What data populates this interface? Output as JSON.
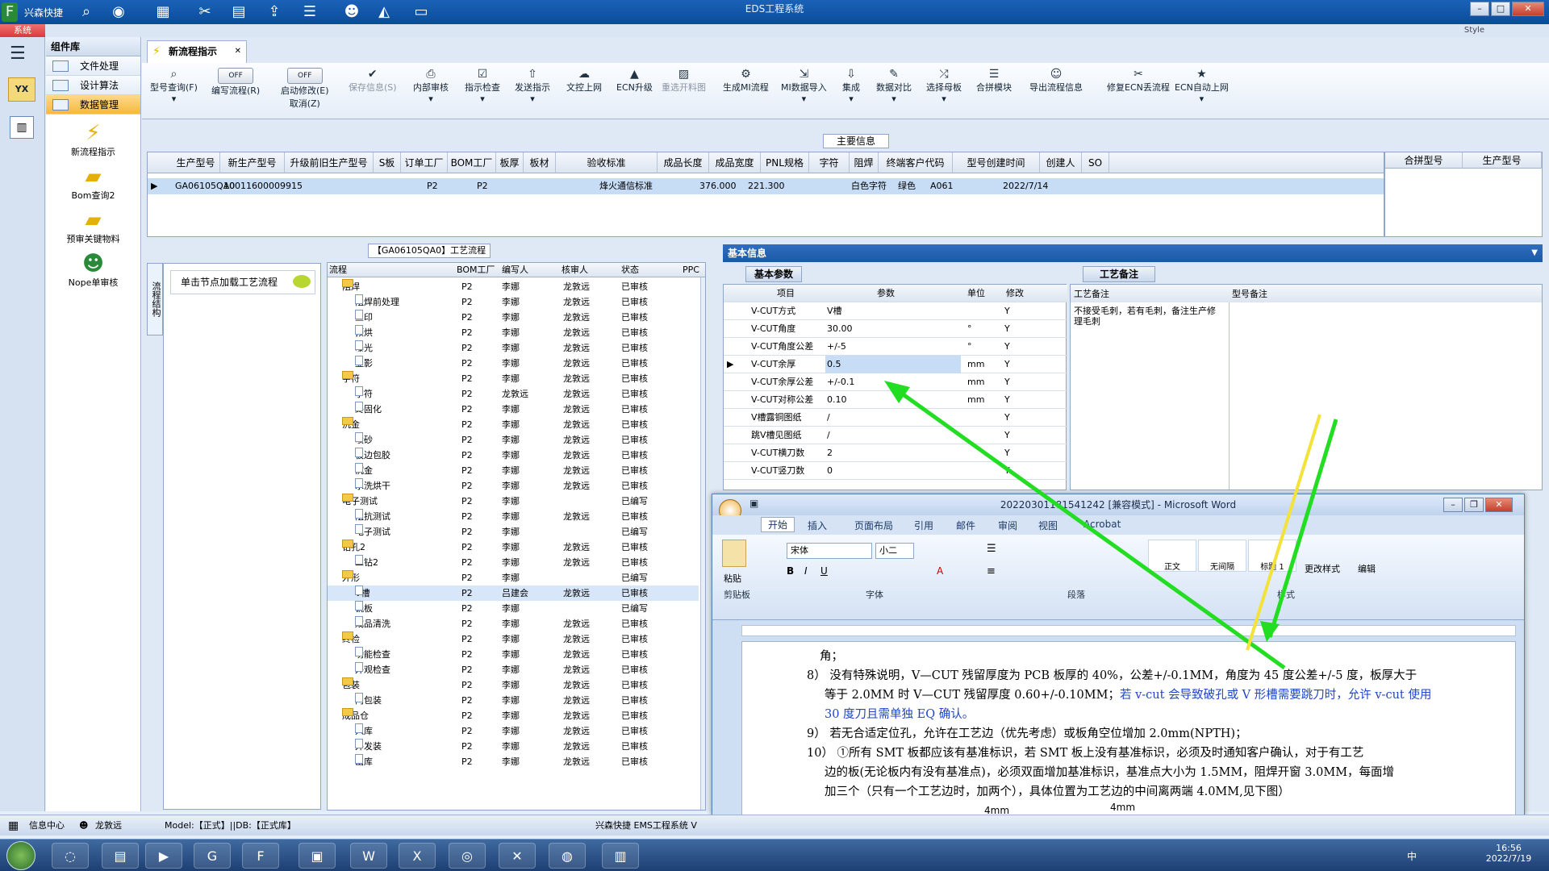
{
  "app": {
    "quick_label": "兴森快捷",
    "title": "EDS工程系统",
    "style_label": "Style",
    "sys_tab": "系统"
  },
  "nav": {
    "header": "组件库",
    "items": [
      {
        "label": "文件处理"
      },
      {
        "label": "设计算法"
      },
      {
        "label": "数据管理"
      }
    ],
    "tools": [
      {
        "label": "新流程指示"
      },
      {
        "label": "Bom查询2"
      },
      {
        "label": "预审关键物料"
      },
      {
        "label": "Nope单审核"
      }
    ]
  },
  "doc_tab": "新流程指示",
  "toolbar": {
    "buttons": [
      {
        "label": "型号查询(F)"
      },
      {
        "label": "编写流程(R)",
        "toggle": "OFF"
      },
      {
        "label": "启动修改(E)",
        "toggle": "OFF",
        "sub": "取消(Z)"
      },
      {
        "label": "保存信息(S)"
      },
      {
        "label": "内部审核"
      },
      {
        "label": "指示检查"
      },
      {
        "label": "发送指示"
      },
      {
        "label": "文控上网"
      },
      {
        "label": "ECN升级"
      },
      {
        "label": "重选开料图"
      },
      {
        "label": "生成MI流程"
      },
      {
        "label": "MI数据导入"
      },
      {
        "label": "集成"
      },
      {
        "label": "数据对比"
      },
      {
        "label": "选择母板"
      },
      {
        "label": "合拼模块"
      },
      {
        "label": "导出流程信息"
      },
      {
        "label": "修复ECN丢流程"
      },
      {
        "label": "ECN自动上网"
      }
    ]
  },
  "main_info": {
    "title": "主要信息",
    "columns": [
      "生产型号",
      "新生产型号",
      "升级前旧生产型号",
      "S板",
      "订单工厂",
      "BOM工厂",
      "板厚",
      "板材",
      "验收标准",
      "成品长度",
      "成品宽度",
      "PNL规格",
      "字符",
      "阻焊",
      "终端客户代码",
      "型号创建时间",
      "创建人",
      "SO"
    ],
    "row": {
      "c0": "GA06105QA0",
      "c1": "10011600009915",
      "c4": "P2",
      "c5": "P2",
      "c8": "烽火通信标准",
      "c9": "376.000",
      "c10": "221.300",
      "c12": "白色字符",
      "c13": "绿色",
      "c14": "A061",
      "c15": "2022/7/14"
    },
    "right_columns": [
      "合拼型号",
      "生产型号"
    ]
  },
  "process": {
    "title": "【GA06105QA0】工艺流程",
    "side_tab": "流程结构",
    "hint": "单击节点加载工艺流程",
    "columns": [
      "流程",
      "BOM工厂",
      "编写人",
      "核审人",
      "状态",
      "PPC"
    ],
    "rows": [
      {
        "n": "阻焊",
        "lv": 0,
        "f": "P2",
        "w": "李娜",
        "c": "龙敦远",
        "s": "已审核"
      },
      {
        "n": "阻焊前处理",
        "lv": 1,
        "f": "P2",
        "w": "李娜",
        "c": "龙敦远",
        "s": "已审核"
      },
      {
        "n": "丝印",
        "lv": 1,
        "f": "P2",
        "w": "李娜",
        "c": "龙敦远",
        "s": "已审核"
      },
      {
        "n": "预烘",
        "lv": 1,
        "f": "P2",
        "w": "李娜",
        "c": "龙敦远",
        "s": "已审核"
      },
      {
        "n": "曝光",
        "lv": 1,
        "f": "P2",
        "w": "李娜",
        "c": "龙敦远",
        "s": "已审核"
      },
      {
        "n": "显影",
        "lv": 1,
        "f": "P2",
        "w": "李娜",
        "c": "龙敦远",
        "s": "已审核"
      },
      {
        "n": "字符",
        "lv": 0,
        "f": "P2",
        "w": "李娜",
        "c": "龙敦远",
        "s": "已审核"
      },
      {
        "n": "字符",
        "lv": 1,
        "f": "P2",
        "w": "龙敦远",
        "c": "龙敦远",
        "s": "已审核"
      },
      {
        "n": "终固化",
        "lv": 1,
        "f": "P2",
        "w": "李娜",
        "c": "龙敦远",
        "s": "已审核"
      },
      {
        "n": "沉金",
        "lv": 0,
        "f": "P2",
        "w": "李娜",
        "c": "龙敦远",
        "s": "已审核"
      },
      {
        "n": "喷砂",
        "lv": 1,
        "f": "P2",
        "w": "李娜",
        "c": "龙敦远",
        "s": "已审核"
      },
      {
        "n": "板边包胶",
        "lv": 1,
        "f": "P2",
        "w": "李娜",
        "c": "龙敦远",
        "s": "已审核"
      },
      {
        "n": "沉金",
        "lv": 1,
        "f": "P2",
        "w": "李娜",
        "c": "龙敦远",
        "s": "已审核"
      },
      {
        "n": "水洗烘干",
        "lv": 1,
        "f": "P2",
        "w": "李娜",
        "c": "龙敦远",
        "s": "已审核"
      },
      {
        "n": "电子测试",
        "lv": 0,
        "f": "P2",
        "w": "李娜",
        "c": "",
        "s": "已编写"
      },
      {
        "n": "阻抗测试",
        "lv": 1,
        "f": "P2",
        "w": "李娜",
        "c": "龙敦远",
        "s": "已审核"
      },
      {
        "n": "电子测试",
        "lv": 1,
        "f": "P2",
        "w": "李娜",
        "c": "",
        "s": "已编写"
      },
      {
        "n": "钻孔2",
        "lv": 0,
        "f": "P2",
        "w": "李娜",
        "c": "龙敦远",
        "s": "已审核"
      },
      {
        "n": "二钻2",
        "lv": 1,
        "f": "P2",
        "w": "李娜",
        "c": "龙敦远",
        "s": "已审核"
      },
      {
        "n": "外形",
        "lv": 0,
        "f": "P2",
        "w": "李娜",
        "c": "",
        "s": "已编写"
      },
      {
        "n": "V槽",
        "lv": 1,
        "f": "P2",
        "w": "吕建会",
        "c": "龙敦远",
        "s": "已审核",
        "sel": true
      },
      {
        "n": "铣板",
        "lv": 1,
        "f": "P2",
        "w": "李娜",
        "c": "",
        "s": "已编写"
      },
      {
        "n": "成品清洗",
        "lv": 1,
        "f": "P2",
        "w": "李娜",
        "c": "龙敦远",
        "s": "已审核"
      },
      {
        "n": "终检",
        "lv": 0,
        "f": "P2",
        "w": "李娜",
        "c": "龙敦远",
        "s": "已审核"
      },
      {
        "n": "功能检查",
        "lv": 1,
        "f": "P2",
        "w": "李娜",
        "c": "龙敦远",
        "s": "已审核"
      },
      {
        "n": "外观检查",
        "lv": 1,
        "f": "P2",
        "w": "李娜",
        "c": "龙敦远",
        "s": "已审核"
      },
      {
        "n": "包装",
        "lv": 0,
        "f": "P2",
        "w": "李娜",
        "c": "龙敦远",
        "s": "已审核"
      },
      {
        "n": "内包装",
        "lv": 1,
        "f": "P2",
        "w": "李娜",
        "c": "龙敦远",
        "s": "已审核"
      },
      {
        "n": "成品仓",
        "lv": 0,
        "f": "P2",
        "w": "李娜",
        "c": "龙敦远",
        "s": "已审核"
      },
      {
        "n": "入库",
        "lv": 1,
        "f": "P2",
        "w": "李娜",
        "c": "龙敦远",
        "s": "已审核"
      },
      {
        "n": "外发装",
        "lv": 1,
        "f": "P2",
        "w": "李娜",
        "c": "龙敦远",
        "s": "已审核"
      },
      {
        "n": "出库",
        "lv": 1,
        "f": "P2",
        "w": "李娜",
        "c": "龙敦远",
        "s": "已审核"
      }
    ]
  },
  "basic": {
    "title": "基本信息",
    "tab": "基本参数",
    "columns": [
      "项目",
      "参数",
      "单位",
      "修改"
    ],
    "rows": [
      {
        "k": "V-CUT方式",
        "v": "V槽",
        "u": "",
        "m": "Y"
      },
      {
        "k": "V-CUT角度",
        "v": "30.00",
        "u": "°",
        "m": "Y"
      },
      {
        "k": "V-CUT角度公差",
        "v": "+/-5",
        "u": "°",
        "m": "Y"
      },
      {
        "k": "V-CUT余厚",
        "v": "0.5",
        "u": "mm",
        "m": "Y",
        "sel": true
      },
      {
        "k": "V-CUT余厚公差",
        "v": "+/-0.1",
        "u": "mm",
        "m": "Y"
      },
      {
        "k": "V-CUT对称公差",
        "v": "0.10",
        "u": "mm",
        "m": "Y"
      },
      {
        "k": "V槽露铜图纸",
        "v": "/",
        "u": "",
        "m": "Y"
      },
      {
        "k": "跳V槽见图纸",
        "v": "/",
        "u": "",
        "m": "Y"
      },
      {
        "k": "V-CUT横刀数",
        "v": "2",
        "u": "",
        "m": "Y"
      },
      {
        "k": "V-CUT竖刀数",
        "v": "0",
        "u": "",
        "m": "Y"
      }
    ]
  },
  "remark": {
    "tab": "工艺备注",
    "col1": "工艺备注",
    "col2": "型号备注",
    "text": "不接受毛刺，若有毛刺，备注生产修理毛刺"
  },
  "word": {
    "title": "20220301181541242 [兼容模式] - Microsoft Word",
    "tabs": [
      "开始",
      "插入",
      "页面布局",
      "引用",
      "邮件",
      "审阅",
      "视图",
      "Acrobat"
    ],
    "font": "宋体",
    "size": "小二",
    "groups": [
      "剪贴板",
      "字体",
      "段落",
      "样式"
    ],
    "paste": "粘贴",
    "styles": [
      "正文",
      "无间隔",
      "标题 1"
    ],
    "change_style": "更改样式",
    "edit": "编辑",
    "lines": [
      "角；",
      "8） 没有特殊说明，V—CUT 残留厚度为 PCB 板厚的 40%，公差+/-0.1MM，角度为 45 度公差+/-5 度，板厚大于",
      "等于 2.0MM 时 V—CUT 残留厚度 0.60+/-0.10MM；",
      "若 v-cut 会导致破孔或 V 形槽需要跳刀时，允许 v-cut 使用",
      "30 度刀且需单独 EQ 确认。",
      "9） 若无合适定位孔，允许在工艺边（优先考虑）或板角空位增加 2.0mm(NPTH)；",
      "10）      ①所有 SMT 板都应该有基准标识，若 SMT 板上没有基准标识，必须及时通知客户确认，对于有工艺",
      "边的板(无论板内有没有基准点)，必须双面增加基准标识，基准点大小为 1.5MM，阻焊开窗 3.0MM，每面增",
      "加三个（只有一个工艺边时，加两个），具体位置为工艺边的中间离两端 4.0MM,见下图）"
    ],
    "dim": "4mm"
  },
  "status": {
    "info": "信息中心",
    "user": "龙敦远",
    "model": "Model:【正式】||DB:【正式库】",
    "right": "兴森快捷 EMS工程系统 V"
  },
  "taskbar": {
    "time": "16:56",
    "date": "2022/7/19",
    "ime": "中"
  }
}
